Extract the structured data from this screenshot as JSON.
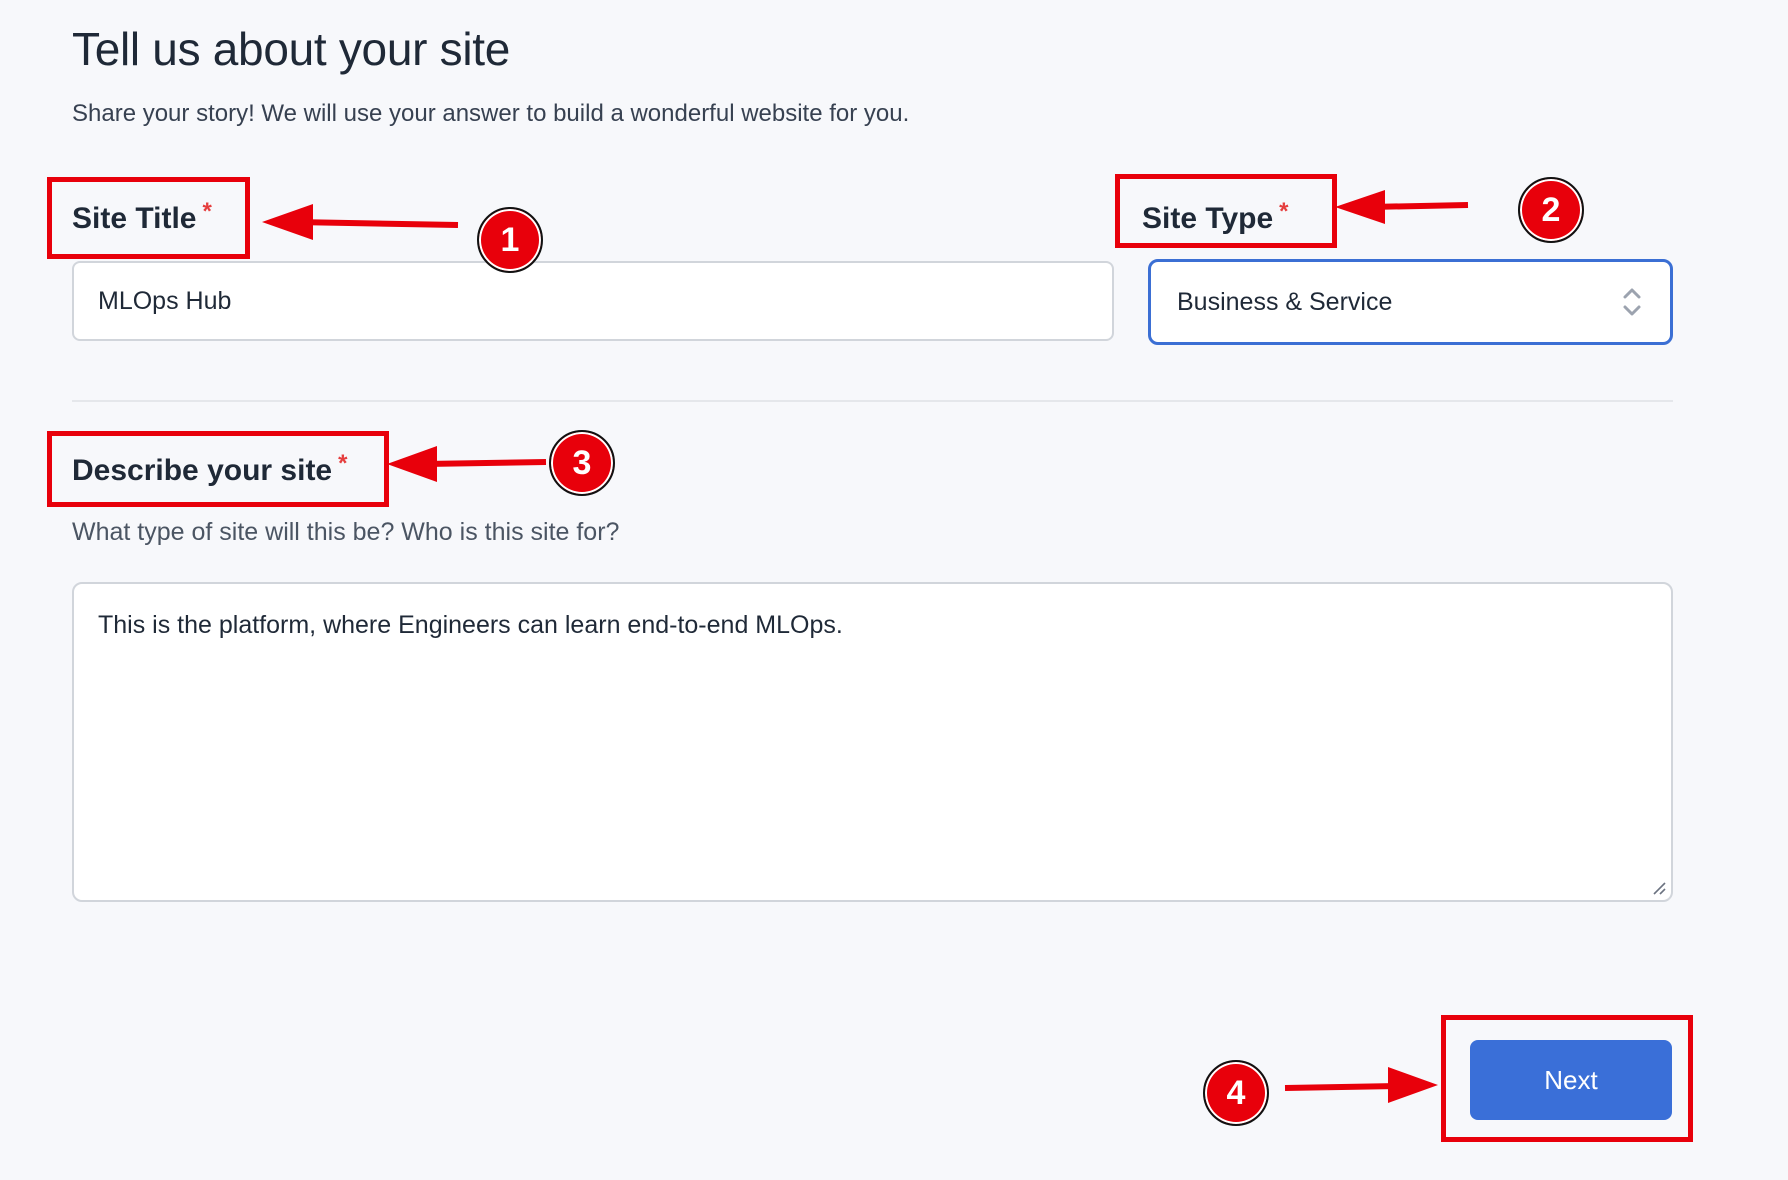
{
  "header": {
    "title": "Tell us about your site",
    "subtitle": "Share your story! We will use your answer to build a wonderful website for you."
  },
  "form": {
    "site_title": {
      "label": "Site Title",
      "required_mark": "*",
      "value": "MLOps Hub"
    },
    "site_type": {
      "label": "Site Type",
      "required_mark": "*",
      "selected": "Business & Service"
    },
    "description": {
      "label": "Describe your site",
      "required_mark": "*",
      "help": "What type of site will this be? Who is this site for?",
      "value": "This is the platform, where Engineers can learn end-to-end MLOps."
    },
    "next_label": "Next"
  },
  "annotations": {
    "badges": [
      "1",
      "2",
      "3",
      "4"
    ],
    "color": "#e8000b"
  },
  "colors": {
    "primary": "#3a6fd8",
    "focus_border": "#3b6fd4",
    "required": "#e53e3e",
    "background": "#f7f8fb"
  },
  "icons": {
    "select_chevrons": "chevron-up-down-icon",
    "resize_grip": "resize-grip-icon"
  }
}
